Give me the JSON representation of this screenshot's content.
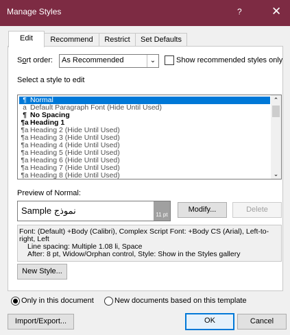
{
  "window": {
    "title": "Manage Styles",
    "help": "?",
    "close": "✕"
  },
  "tabs": [
    {
      "label": "Edit",
      "active": true
    },
    {
      "label": "Recommend",
      "active": false
    },
    {
      "label": "Restrict",
      "active": false
    },
    {
      "label": "Set Defaults",
      "active": false
    }
  ],
  "sort": {
    "label_pre": "S",
    "label_ul": "o",
    "label_post": "rt order:",
    "value": "As Recommended",
    "show_recommended": "Show recommended styles only"
  },
  "select_label": "Select a style to edit",
  "styles": [
    {
      "icon": "¶",
      "name": "Normal",
      "selected": true,
      "bold": true
    },
    {
      "icon": "a",
      "name": "Default Paragraph Font  (Hide Until Used)",
      "selected": false,
      "bold": false
    },
    {
      "icon": "¶",
      "name": "No Spacing",
      "selected": false,
      "bold": true
    },
    {
      "icon": "¶a",
      "name": "Heading 1",
      "selected": false,
      "bold": true
    },
    {
      "icon": "¶a",
      "name": "Heading 2  (Hide Until Used)",
      "selected": false,
      "bold": false
    },
    {
      "icon": "¶a",
      "name": "Heading 3  (Hide Until Used)",
      "selected": false,
      "bold": false
    },
    {
      "icon": "¶a",
      "name": "Heading 4  (Hide Until Used)",
      "selected": false,
      "bold": false
    },
    {
      "icon": "¶a",
      "name": "Heading 5  (Hide Until Used)",
      "selected": false,
      "bold": false
    },
    {
      "icon": "¶a",
      "name": "Heading 6  (Hide Until Used)",
      "selected": false,
      "bold": false
    },
    {
      "icon": "¶a",
      "name": "Heading 7  (Hide Until Used)",
      "selected": false,
      "bold": false
    },
    {
      "icon": "¶a",
      "name": "Heading 8  (Hide Until Used)",
      "selected": false,
      "bold": false
    }
  ],
  "preview": {
    "label": "Preview of Normal:",
    "sample": "Sample نموذج",
    "size": "11 pt"
  },
  "buttons": {
    "modify": "Modify...",
    "delete": "Delete",
    "new_style": "New Style...",
    "import_export": "Import/Export...",
    "ok": "OK",
    "cancel": "Cancel"
  },
  "description": {
    "line1": "Font: (Default) +Body (Calibri), Complex Script Font: +Body CS (Arial), Left-to-",
    "line2": "right, Left",
    "line3": "Line spacing:  Multiple 1.08 li, Space",
    "line4": "After:  8 pt, Widow/Orphan control, Style: Show in the Styles gallery"
  },
  "scope": {
    "option1": "Only in this document",
    "option2": "New documents based on this template",
    "selected": "option1"
  }
}
